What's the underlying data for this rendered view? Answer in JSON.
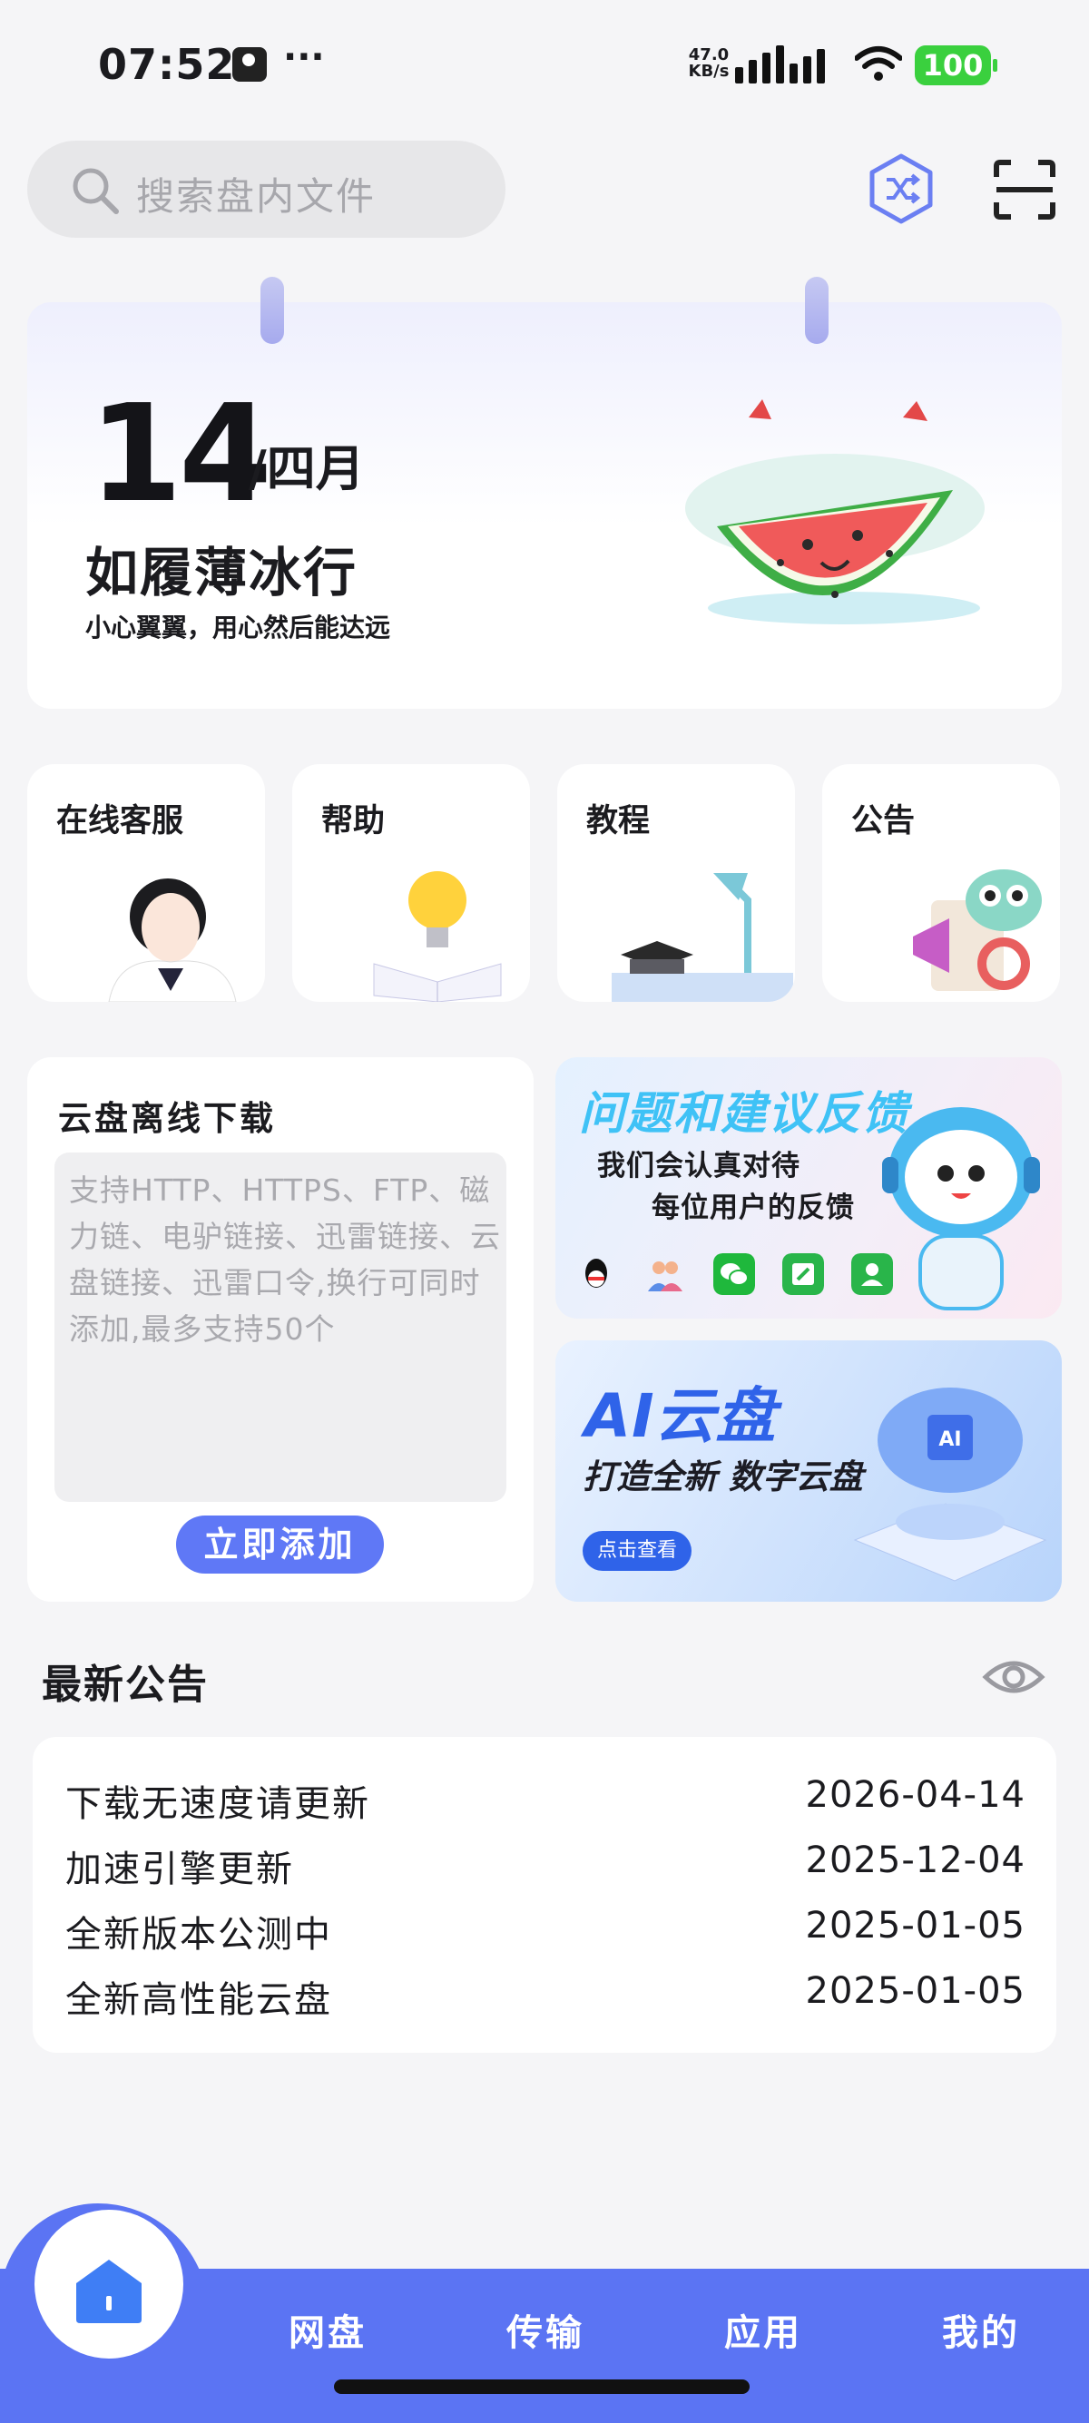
{
  "status_bar": {
    "time": "07:52",
    "more": "···",
    "net_speed_value": "47.0",
    "net_speed_unit": "KB/s",
    "battery": "100"
  },
  "search": {
    "placeholder": "搜索盘内文件"
  },
  "calendar": {
    "day": "14",
    "month": "/四月",
    "title": "如履薄冰行",
    "subtitle": "小心翼翼，用心然后能达远"
  },
  "quick_tiles": [
    {
      "label": "在线客服",
      "icon": "customer-service-icon"
    },
    {
      "label": "帮助",
      "icon": "lightbulb-book-icon"
    },
    {
      "label": "教程",
      "icon": "graduation-lamp-icon"
    },
    {
      "label": "公告",
      "icon": "megaphone-icon"
    }
  ],
  "offline_download": {
    "title": "云盘离线下载",
    "placeholder": "支持HTTP、HTTPS、FTP、磁力链、电驴链接、迅雷链接、云盘链接、迅雷口令,换行可同时添加,最多支持50个",
    "button": "立即添加"
  },
  "feedback_banner": {
    "title": "问题和建议反馈",
    "line1": "我们会认真对待",
    "line2": "每位用户的反馈",
    "icons": [
      "qq-icon",
      "group-icon",
      "wechat-icon",
      "edit-icon",
      "contact-icon"
    ]
  },
  "ai_banner": {
    "title": "AI云盘",
    "subtitle": "打造全新 数字云盘",
    "button": "点击查看"
  },
  "announcements": {
    "heading": "最新公告",
    "items": [
      {
        "title": "下载无速度请更新",
        "date": "2026-04-14"
      },
      {
        "title": "加速引擎更新",
        "date": "2025-12-04"
      },
      {
        "title": "全新版本公测中",
        "date": "2025-01-05"
      },
      {
        "title": "全新高性能云盘",
        "date": "2025-01-05"
      }
    ]
  },
  "tabbar": {
    "tabs": [
      "网盘",
      "传输",
      "应用",
      "我的"
    ]
  },
  "colors": {
    "accent": "#5b74f3",
    "background": "#f5f5f7",
    "battery": "#3ad03e"
  }
}
